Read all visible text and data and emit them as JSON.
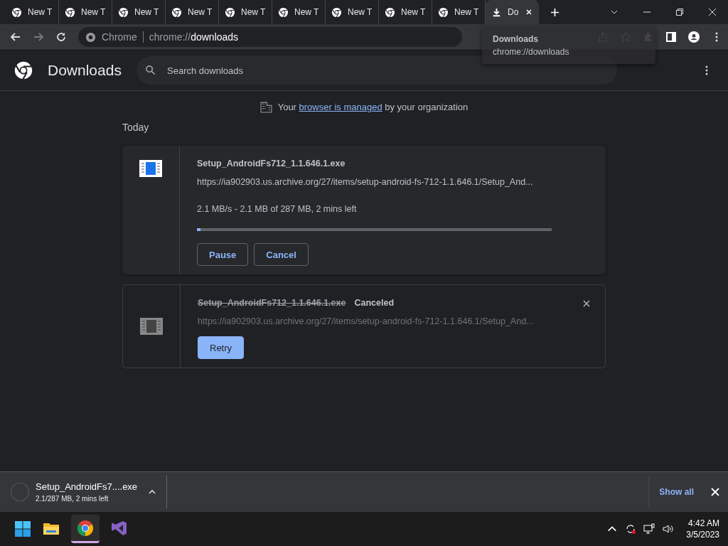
{
  "tabs": [
    {
      "title": "New T",
      "kind": "newtab",
      "selected": false
    },
    {
      "title": "New T",
      "kind": "newtab",
      "selected": false
    },
    {
      "title": "New T",
      "kind": "newtab",
      "selected": false
    },
    {
      "title": "New T",
      "kind": "newtab",
      "selected": false
    },
    {
      "title": "New T",
      "kind": "newtab",
      "selected": false
    },
    {
      "title": "New T",
      "kind": "newtab",
      "selected": false
    },
    {
      "title": "New T",
      "kind": "newtab",
      "selected": false
    },
    {
      "title": "New T",
      "kind": "newtab",
      "selected": false
    },
    {
      "title": "New T",
      "kind": "newtab",
      "selected": false
    },
    {
      "title": "Do",
      "kind": "downloads",
      "selected": true
    }
  ],
  "omnibox": {
    "site": "Chrome",
    "url_prefix": "chrome://",
    "url_path": "downloads"
  },
  "tooltip": {
    "title": "Downloads",
    "url": "chrome://downloads"
  },
  "page": {
    "title": "Downloads",
    "search_placeholder": "Search downloads"
  },
  "managed_notice": {
    "before": "Your",
    "link": "browser is managed",
    "after": "by your organization"
  },
  "date_group": "Today",
  "downloads": [
    {
      "kind": "in_progress",
      "file": "Setup_AndroidFs712_1.1.646.1.exe",
      "url": "https://ia902903.us.archive.org/27/items/setup-android-fs-712-1.1.646.1/Setup_And...",
      "progress_text": "2.1 MB/s - 2.1 MB of 287 MB, 2 mins left",
      "level": 0.01,
      "buttons": [
        "Pause",
        "Cancel"
      ]
    },
    {
      "kind": "canceled",
      "file": "Setup_AndroidFs712_1.1.646.1.exe",
      "status": "Canceled",
      "url": "https://ia902903.us.archive.org/27/items/setup-android-fs-712-1.1.646.1/Setup_And...",
      "buttons": [
        "Retry"
      ]
    }
  ],
  "shelf": {
    "file": "Setup_AndroidFs7....exe",
    "detail": "2.1/287 MB, 2 mins left",
    "show_all": "Show all"
  },
  "taskbar": {
    "apps": [
      {
        "kind": "files",
        "selected": false
      },
      {
        "kind": "chrome",
        "selected": true
      },
      {
        "kind": "studio",
        "selected": false
      }
    ],
    "time": "4:42 AM",
    "date": "3/5/2023"
  }
}
